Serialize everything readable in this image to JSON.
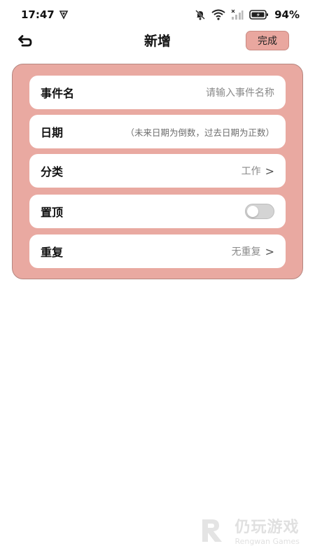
{
  "status_bar": {
    "time": "17:47",
    "battery": "94%",
    "icons": [
      "shield-icon",
      "bell-off-icon",
      "wifi-icon",
      "signal-icon",
      "battery-icon"
    ]
  },
  "header": {
    "title": "新增",
    "done_label": "完成",
    "back_icon": "back-arrow-icon"
  },
  "colors": {
    "accent": "#e9a9a1",
    "card_border": "#b58680",
    "placeholder": "#8a8a8a"
  },
  "form": {
    "event_name": {
      "label": "事件名",
      "placeholder": "请输入事件名称"
    },
    "date": {
      "label": "日期",
      "hint": "（未来日期为倒数，过去日期为正数）"
    },
    "category": {
      "label": "分类",
      "value": "工作",
      "chevron": ">"
    },
    "pin_top": {
      "label": "置顶",
      "enabled": false
    },
    "repeat": {
      "label": "重复",
      "value": "无重复",
      "chevron": ">"
    }
  },
  "watermark": {
    "cn": "仍玩游戏",
    "en": "Rengwan Games"
  }
}
